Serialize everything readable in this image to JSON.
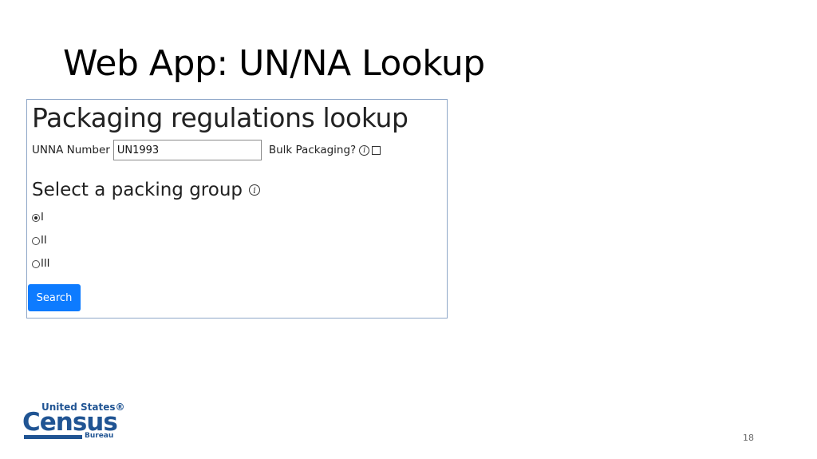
{
  "slide": {
    "title": "Web App: UN/NA Lookup",
    "page_number": "18"
  },
  "app": {
    "heading": "Packaging regulations lookup",
    "unna_label": "UNNA Number",
    "unna_value": "UN1993",
    "bulk_label": "Bulk Packaging?",
    "bulk_checked": false,
    "group_heading": "Select a packing group",
    "packing_groups": [
      {
        "label": "I",
        "checked": true
      },
      {
        "label": "II",
        "checked": false
      },
      {
        "label": "III",
        "checked": false
      }
    ],
    "search_label": "Search"
  },
  "logo": {
    "line1": "United States®",
    "line2": "Census",
    "line3": "Bureau",
    "color": "#205493"
  },
  "colors": {
    "button": "#0d7bff",
    "frame_border": "#8fa7c8"
  },
  "icons": {
    "info": "info-circle-icon"
  }
}
